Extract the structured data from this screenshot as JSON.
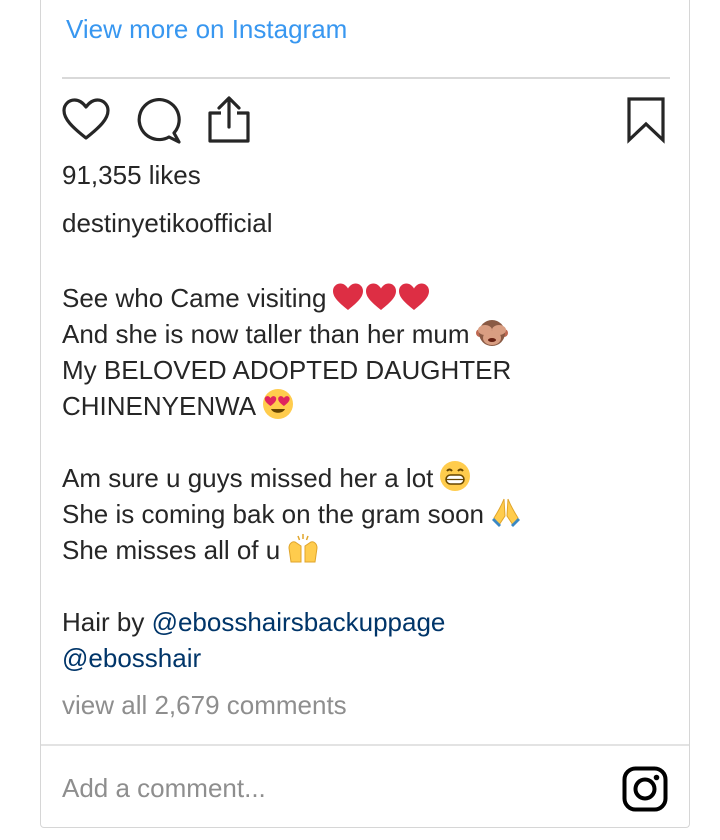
{
  "embed": {
    "view_more_label": "View more on Instagram"
  },
  "actions": {
    "like_icon": "heart-outline-icon",
    "comment_icon": "speech-bubble-icon",
    "share_icon": "share-upload-icon",
    "save_icon": "bookmark-icon"
  },
  "post": {
    "likes": "91,355 likes",
    "username": "destinyetikoofficial",
    "caption": {
      "line1": "See who Came visiting",
      "line2": "And she is now taller than her mum",
      "line3": "My BELOVED ADOPTED DAUGHTER",
      "line4": "CHINENYENWA",
      "line5": "Am sure u guys missed her a lot",
      "line6": "She is coming bak on the gram soon",
      "line7": "She misses all of u",
      "line8_prefix": "Hair by ",
      "mention1": "@ebosshairsbackuppage",
      "mention2": "@ebosshair"
    },
    "view_comments": "view all 2,679 comments"
  },
  "comment_box": {
    "placeholder": "Add a comment...",
    "logo_icon": "instagram-logo-icon"
  },
  "colors": {
    "link_blue": "#3897f0",
    "text": "#262626",
    "muted": "#8e8e8e",
    "mention": "#003569",
    "heart_red": "#dd2e44"
  }
}
